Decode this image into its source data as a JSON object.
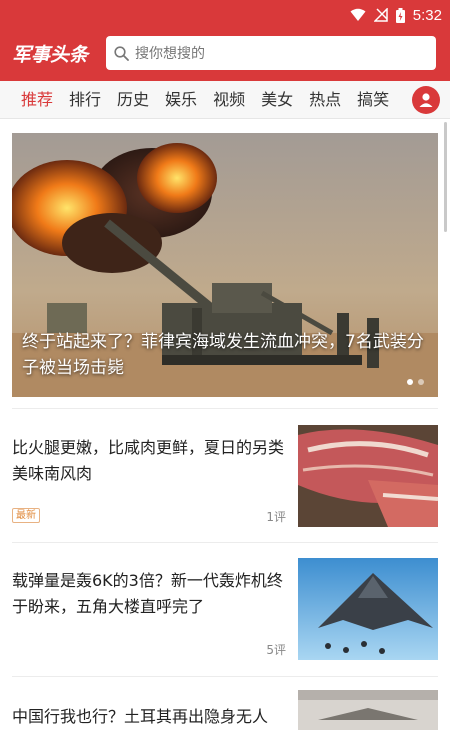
{
  "status_bar": {
    "time": "5:32",
    "icons": [
      "wifi-icon",
      "signal-icon",
      "battery-charging-icon"
    ]
  },
  "app": {
    "logo_text": "军事头条"
  },
  "search": {
    "placeholder": "搜你想搜的",
    "icon": "search-icon"
  },
  "tabs": [
    {
      "label": "推荐",
      "active": true
    },
    {
      "label": "排行",
      "active": false
    },
    {
      "label": "历史",
      "active": false
    },
    {
      "label": "娱乐",
      "active": false
    },
    {
      "label": "视频",
      "active": false
    },
    {
      "label": "美女",
      "active": false
    },
    {
      "label": "热点",
      "active": false
    },
    {
      "label": "搞笑",
      "active": false
    }
  ],
  "user_icon": "user-avatar-icon",
  "banner": {
    "title": "终于站起来了？菲律宾海域发生流血冲突，7名武装分子被当场击毙",
    "page_indicator": {
      "count": 2,
      "current": 1
    }
  },
  "news": [
    {
      "title": "比火腿更嫩，比咸肉更鲜，夏日的另类美味南风肉",
      "badge": "最新",
      "comments": "1评"
    },
    {
      "title": "载弹量是轰6K的3倍？新一代轰炸机终于盼来，五角大楼直呼完了",
      "badge": "",
      "comments": "5评"
    },
    {
      "title": "中国行我也行？土耳其再出隐身无人",
      "badge": "",
      "comments": ""
    }
  ],
  "colors": {
    "brand_red": "#d9393a",
    "badge_orange": "#e08a3c"
  }
}
